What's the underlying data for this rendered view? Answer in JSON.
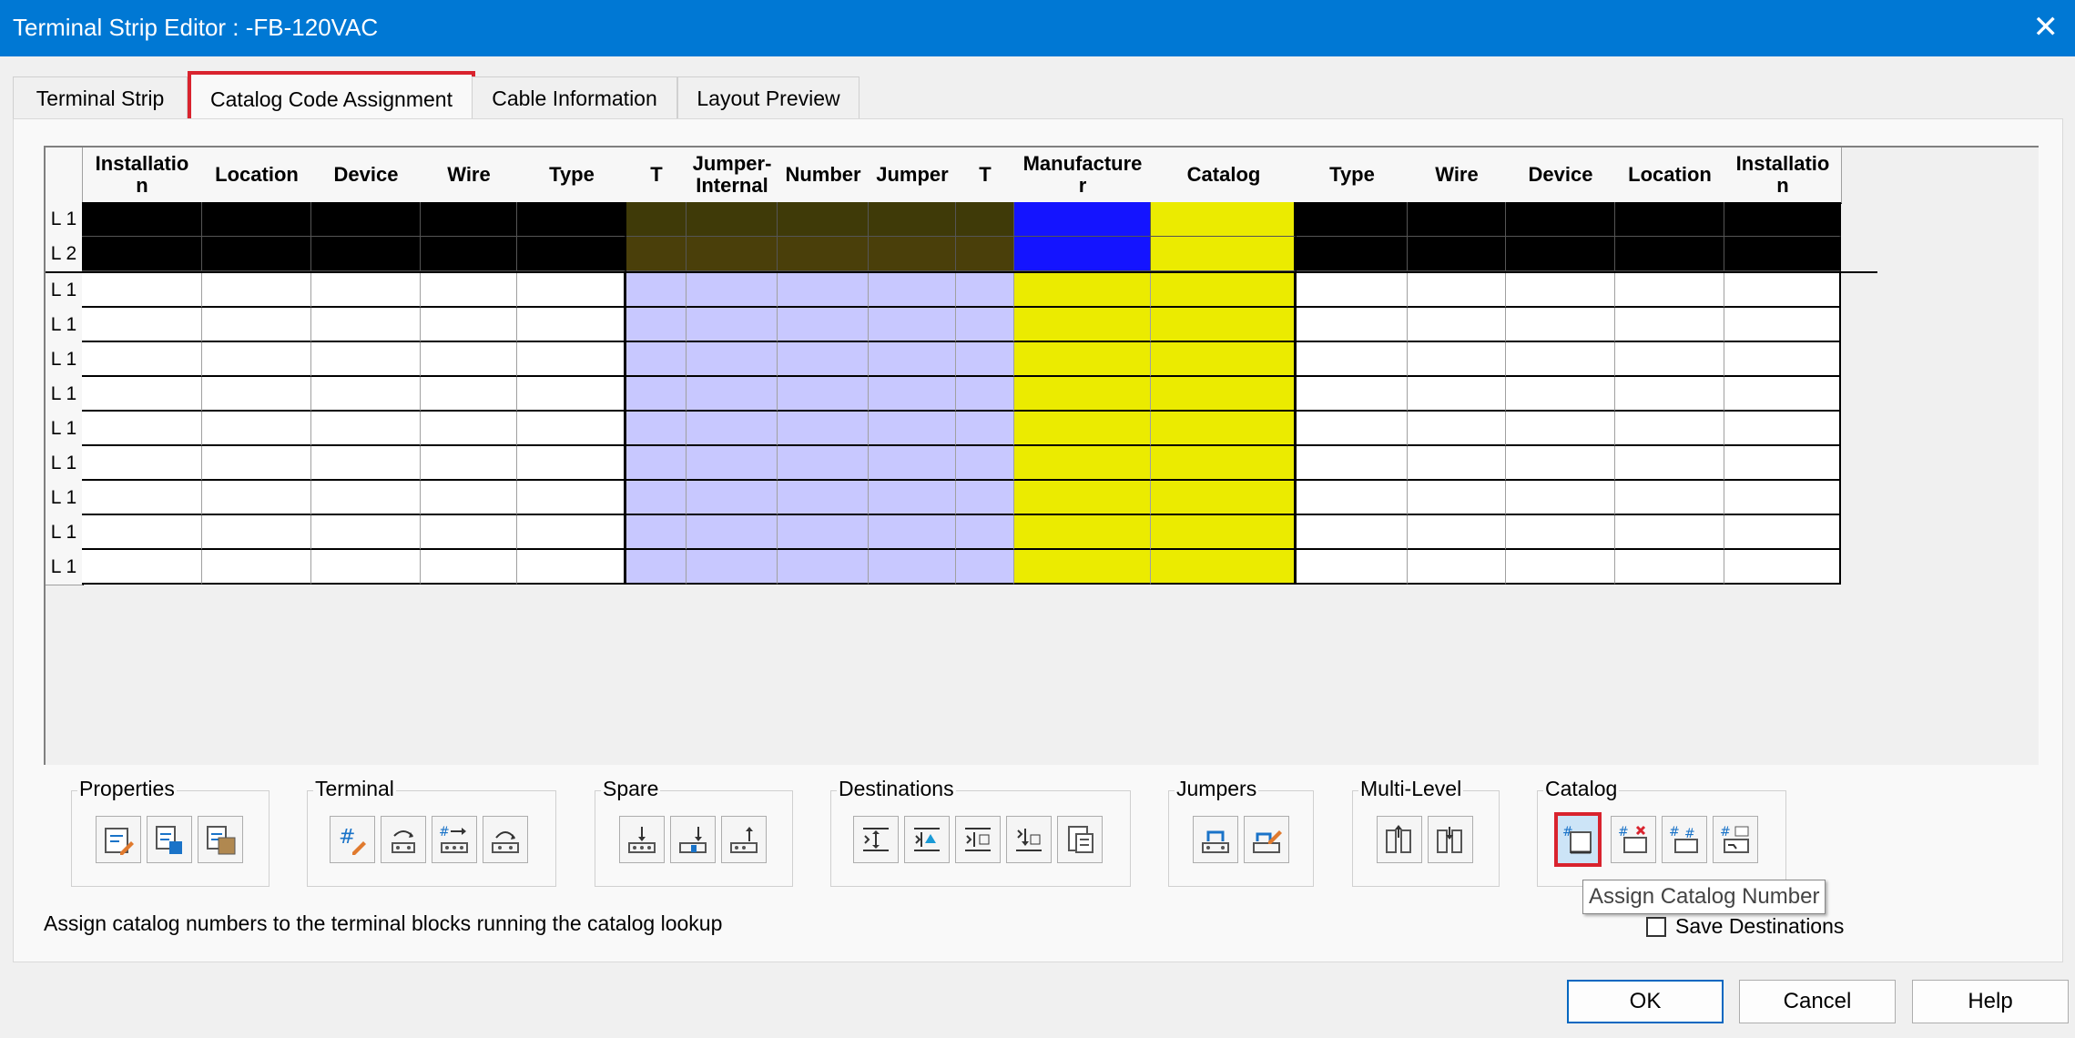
{
  "window": {
    "title": "Terminal Strip Editor : -FB-120VAC"
  },
  "tabs": [
    {
      "label": "Terminal Strip"
    },
    {
      "label": "Catalog Code Assignment"
    },
    {
      "label": "Cable Information"
    },
    {
      "label": "Layout Preview"
    }
  ],
  "grid": {
    "columns": [
      "Installatio\nn",
      "Location",
      "Device",
      "Wire",
      "Type",
      "T",
      "Jumper-\nInternal",
      "Number",
      "Jumper",
      "T",
      "Manufacture\nr",
      "Catalog",
      "Type",
      "Wire",
      "Device",
      "Location",
      "Installatio\nn"
    ],
    "rows": [
      "L 1",
      "L 2",
      "L 1",
      "L 1",
      "L 1",
      "L 1",
      "L 1",
      "L 1",
      "L 1",
      "L 1",
      "L 1"
    ],
    "colors": {
      "selected_black": "#000000",
      "selected_olive": "#3f3a08",
      "selected_olive2": "#4a3f0a",
      "terminal_lavender": "#c8c8ff",
      "catalog_yellow": "#ebeb00",
      "manufacturer_blue": "#1414ff",
      "white": "#ffffff"
    }
  },
  "groups": [
    {
      "label": "Properties",
      "buttons": [
        "edit-properties-icon",
        "copy-properties-icon",
        "paste-properties-icon"
      ]
    },
    {
      "label": "Terminal",
      "buttons": [
        "edit-terminal-number-icon",
        "move-terminal-icon",
        "renumber-terminal-icon",
        "reverse-terminal-icon"
      ]
    },
    {
      "label": "Spare",
      "buttons": [
        "insert-spare-icon",
        "insert-spare-below-icon",
        "remove-spare-icon"
      ]
    },
    {
      "label": "Destinations",
      "buttons": [
        "flip-destinations-icon",
        "move-destination-up-icon",
        "swap-destinations-icon",
        "move-destination-down-icon",
        "destinations-report-icon"
      ]
    },
    {
      "label": "Jumpers",
      "buttons": [
        "add-jumper-icon",
        "edit-jumper-icon"
      ]
    },
    {
      "label": "Multi-Level",
      "buttons": [
        "multi-level-left-icon",
        "multi-level-right-icon"
      ]
    },
    {
      "label": "Catalog",
      "buttons": [
        "assign-catalog-icon",
        "remove-catalog-icon",
        "copy-catalog-icon",
        "catalog-lookup-icon"
      ]
    }
  ],
  "status": {
    "text": "Assign catalog numbers to the terminal blocks running the catalog lookup"
  },
  "tooltip": {
    "text": "Assign Catalog Number"
  },
  "save_destinations": {
    "label": "Save Destinations"
  },
  "footer": {
    "ok": "OK",
    "cancel": "Cancel",
    "help": "Help"
  }
}
